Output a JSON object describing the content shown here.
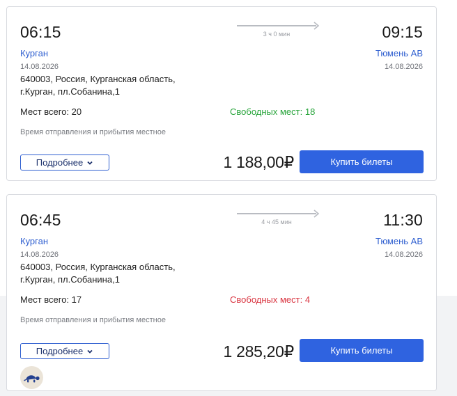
{
  "trips": [
    {
      "departure_time": "06:15",
      "arrival_time": "09:15",
      "duration": "3 ч 0 мин",
      "departure_city": "Курган",
      "arrival_city": "Тюмень АВ",
      "departure_date": "14.08.2026",
      "arrival_date": "14.08.2026",
      "address_line1": "640003, Россия, Курганская область,",
      "address_line2": "г.Курган, пл.Собанина,1",
      "seats_total": "Мест всего: 20",
      "seats_free": "Свободных мест: 18",
      "seats_free_color": "#27a43a",
      "local_time_note": "Время отправления и прибытия местное",
      "details_label": "Подробнее",
      "price": "1 188,00₽",
      "buy_label": "Купить билеты"
    },
    {
      "departure_time": "06:45",
      "arrival_time": "11:30",
      "duration": "4 ч 45 мин",
      "departure_city": "Курган",
      "arrival_city": "Тюмень АВ",
      "departure_date": "14.08.2026",
      "arrival_date": "14.08.2026",
      "address_line1": "640003, Россия, Курганская область,",
      "address_line2": "г.Курган, пл.Собанина,1",
      "seats_total": "Мест всего: 17",
      "seats_free": "Свободных мест: 4",
      "seats_free_color": "#d9333f",
      "local_time_note": "Время отправления и прибытия местное",
      "details_label": "Подробнее",
      "price": "1 285,20₽",
      "buy_label": "Купить билеты"
    }
  ],
  "icons": {
    "route_arrow": "arrow-right-icon",
    "details_chevron": "chevron-down-icon",
    "assistant": "turtle-icon"
  },
  "colors": {
    "accent": "#2f63e0",
    "link": "#2f5fd0"
  }
}
